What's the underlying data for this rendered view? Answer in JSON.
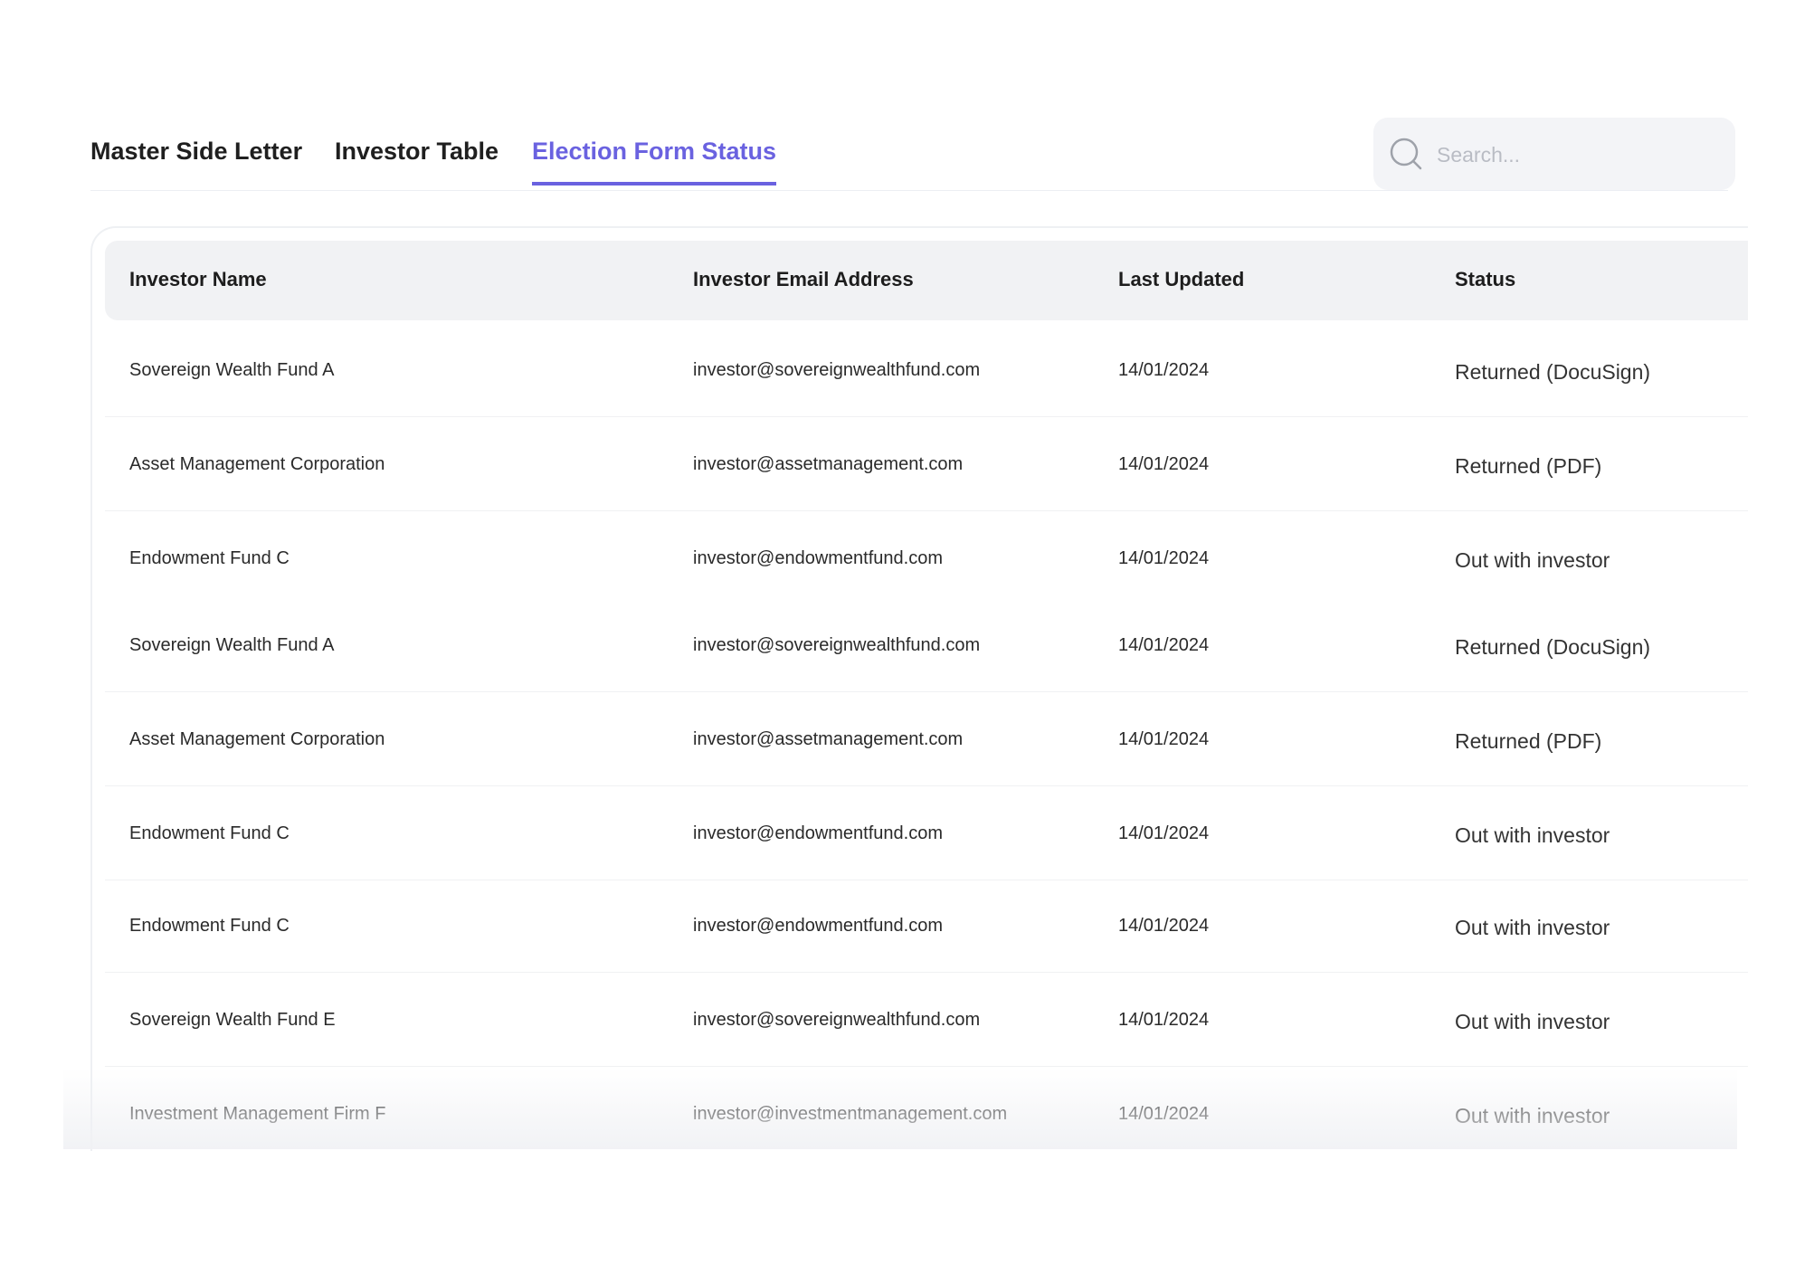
{
  "tabs": [
    {
      "label": "Master Side Letter",
      "active": false
    },
    {
      "label": "Investor Table",
      "active": false
    },
    {
      "label": "Election Form Status",
      "active": true
    }
  ],
  "colors": {
    "accent": "#6a62e0"
  },
  "search": {
    "placeholder": "Search...",
    "icon": "search-icon"
  },
  "table": {
    "headers": [
      "Investor Name",
      "Investor Email Address",
      "Last Updated",
      "Status"
    ],
    "rows": [
      {
        "name": "Sovereign Wealth Fund A",
        "email": "investor@sovereignwealthfund.com",
        "updated": "14/01/2024",
        "status": "Returned (DocuSign)"
      },
      {
        "name": "Asset Management Corporation",
        "email": "investor@assetmanagement.com",
        "updated": "14/01/2024",
        "status": "Returned (PDF)"
      },
      {
        "name": "Endowment Fund C",
        "email": "investor@endowmentfund.com",
        "updated": "14/01/2024",
        "status": "Out with investor"
      },
      {
        "name": "Sovereign Wealth Fund A",
        "email": "investor@sovereignwealthfund.com",
        "updated": "14/01/2024",
        "status": "Returned (DocuSign)"
      },
      {
        "name": "Asset Management Corporation",
        "email": "investor@assetmanagement.com",
        "updated": "14/01/2024",
        "status": "Returned (PDF)"
      },
      {
        "name": "Endowment Fund C",
        "email": "investor@endowmentfund.com",
        "updated": "14/01/2024",
        "status": "Out with investor"
      },
      {
        "name": "Endowment Fund C",
        "email": "investor@endowmentfund.com",
        "updated": "14/01/2024",
        "status": "Out with investor"
      },
      {
        "name": "Sovereign Wealth Fund E",
        "email": "investor@sovereignwealthfund.com",
        "updated": "14/01/2024",
        "status": "Out with investor"
      },
      {
        "name": "Investment Management Firm F",
        "email": "investor@investmentmanagement.com",
        "updated": "14/01/2024",
        "status": "Out with investor"
      }
    ]
  }
}
